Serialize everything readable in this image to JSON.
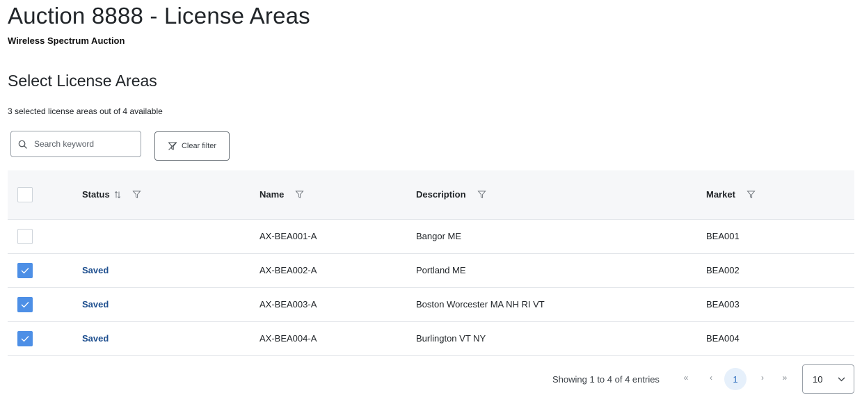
{
  "header": {
    "title": "Auction 8888 - License Areas",
    "subtitle": "Wireless Spectrum Auction"
  },
  "section": {
    "title": "Select License Areas",
    "summary": "3 selected license areas out of 4 available"
  },
  "toolbar": {
    "search_placeholder": "Search keyword",
    "search_value": "",
    "clear_filter_label": "Clear filter"
  },
  "table": {
    "columns": {
      "status": "Status",
      "name": "Name",
      "description": "Description",
      "market": "Market"
    },
    "rows": [
      {
        "checked": false,
        "status": "",
        "name": "AX-BEA001-A",
        "description": "Bangor ME",
        "market": "BEA001"
      },
      {
        "checked": true,
        "status": "Saved",
        "name": "AX-BEA002-A",
        "description": "Portland ME",
        "market": "BEA002"
      },
      {
        "checked": true,
        "status": "Saved",
        "name": "AX-BEA003-A",
        "description": "Boston Worcester MA NH RI VT",
        "market": "BEA003"
      },
      {
        "checked": true,
        "status": "Saved",
        "name": "AX-BEA004-A",
        "description": "Burlington VT NY",
        "market": "BEA004"
      }
    ]
  },
  "pagination": {
    "info": "Showing 1 to 4 of 4 entries",
    "first": "«",
    "prev": "‹",
    "current_page": "1",
    "next": "›",
    "last": "»",
    "page_size": "10"
  },
  "colors": {
    "accent": "#4d8fe6",
    "status_saved": "#1e4f8f",
    "header_bg": "#f6f7f9"
  },
  "icons": {
    "search": "search-icon",
    "clear_filter": "filter-clear-icon",
    "filter": "filter-icon",
    "sort": "sort-icon",
    "check": "check-icon",
    "chevron_down": "chevron-down-icon"
  }
}
